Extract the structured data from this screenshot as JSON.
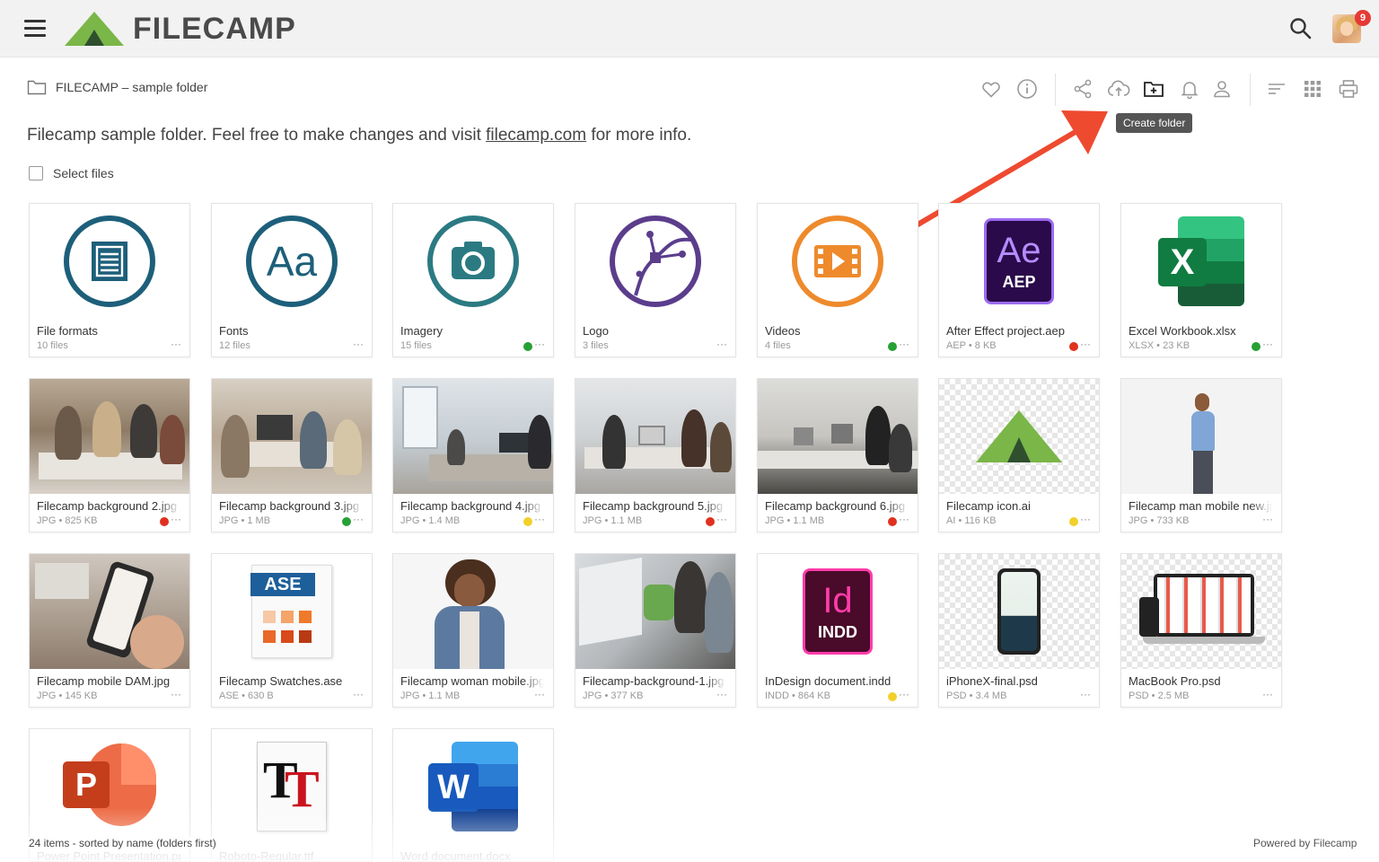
{
  "header": {
    "logo_text": "FILECAMP",
    "notification_count": "9"
  },
  "breadcrumb": {
    "path": "FILECAMP – sample folder"
  },
  "toolbar": {
    "tooltip": "Create folder",
    "icons": [
      "heart-icon",
      "info-icon",
      "share-icon",
      "upload-cloud-icon",
      "create-folder-icon",
      "bell-icon",
      "user-icon",
      "sort-icon",
      "grid-view-icon",
      "print-icon"
    ]
  },
  "description": {
    "before": "Filecamp sample folder. Feel free to make changes and visit ",
    "link": "filecamp.com",
    "after": " for more info."
  },
  "select_files_label": "Select files",
  "items": [
    {
      "name": "File formats",
      "meta": "10 files",
      "dot": null
    },
    {
      "name": "Fonts",
      "meta": "12 files",
      "dot": null
    },
    {
      "name": "Imagery",
      "meta": "15 files",
      "dot": "#27a035"
    },
    {
      "name": "Logo",
      "meta": "3 files",
      "dot": null
    },
    {
      "name": "Videos",
      "meta": "4 files",
      "dot": "#27a035"
    },
    {
      "name": "After Effect project.aep",
      "meta": "AEP • 8 KB",
      "dot": "#e03020"
    },
    {
      "name": "Excel Workbook.xlsx",
      "meta": "XLSX • 23 KB",
      "dot": "#27a035"
    },
    {
      "name": "Filecamp background 2.jpg",
      "meta": "JPG • 825 KB",
      "dot": "#e03020"
    },
    {
      "name": "Filecamp background 3.jpg",
      "meta": "JPG • 1 MB",
      "dot": "#27a035"
    },
    {
      "name": "Filecamp background 4.jpg",
      "meta": "JPG • 1.4 MB",
      "dot": "#f2d02a"
    },
    {
      "name": "Filecamp background 5.jpg",
      "meta": "JPG • 1.1 MB",
      "dot": "#e03020"
    },
    {
      "name": "Filecamp background 6.jpg",
      "meta": "JPG • 1.1 MB",
      "dot": "#e03020"
    },
    {
      "name": "Filecamp icon.ai",
      "meta": "AI • 116 KB",
      "dot": "#f2d02a"
    },
    {
      "name": "Filecamp man mobile new.jpg",
      "meta": "JPG • 733 KB",
      "dot": null
    },
    {
      "name": "Filecamp mobile DAM.jpg",
      "meta": "JPG • 145 KB",
      "dot": null
    },
    {
      "name": "Filecamp Swatches.ase",
      "meta": "ASE • 630 B",
      "dot": null
    },
    {
      "name": "Filecamp woman mobile.jpg",
      "meta": "JPG • 1.1 MB",
      "dot": null
    },
    {
      "name": "Filecamp-background-1.jpg",
      "meta": "JPG • 377 KB",
      "dot": null
    },
    {
      "name": "InDesign document.indd",
      "meta": "INDD • 864 KB",
      "dot": "#f2d02a"
    },
    {
      "name": "iPhoneX-final.psd",
      "meta": "PSD • 3.4 MB",
      "dot": null
    },
    {
      "name": "MacBook Pro.psd",
      "meta": "PSD • 2.5 MB",
      "dot": null
    },
    {
      "name": "Power Point Presentation.pptx",
      "meta": "",
      "dot": null
    },
    {
      "name": "Roboto-Regular.ttf",
      "meta": "",
      "dot": null
    },
    {
      "name": "Word document.docx",
      "meta": "",
      "dot": null
    }
  ],
  "tile_labels": {
    "ae": "Ae",
    "aep": "AEP",
    "excel": "X",
    "ase": "ASE",
    "id": "Id",
    "indd": "INDD",
    "ppt": "P",
    "font": "T",
    "word": "W"
  },
  "footer": {
    "summary": "24 items - sorted by name (folders first)",
    "powered": "Powered by Filecamp"
  },
  "colors": {
    "folder_blue": "#1d5f7a",
    "folder_teal": "#2b7a82",
    "folder_purple": "#5b3d8c",
    "folder_orange": "#ee8a2c",
    "annotation_arrow": "#ee4a30",
    "logo_green": "#7ab648"
  }
}
